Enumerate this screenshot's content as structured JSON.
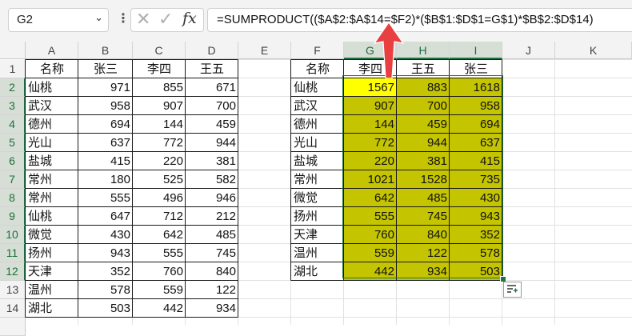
{
  "formula_bar": {
    "name_box": "G2",
    "name_box_arrow": "⌄",
    "menu_glyph": "⋮",
    "cancel_glyph": "✕",
    "enter_glyph": "✓",
    "fx_label": "fx",
    "formula": "=SUMPRODUCT(($A$2:$A$14=$F2)*($B$1:$D$1=G$1)*$B$2:$D$14)"
  },
  "columns": [
    "A",
    "B",
    "C",
    "D",
    "E",
    "F",
    "G",
    "H",
    "I",
    "J",
    "K"
  ],
  "rows": [
    "1",
    "2",
    "3",
    "4",
    "5",
    "6",
    "7",
    "8",
    "9",
    "10",
    "11",
    "12",
    "13",
    "14",
    ""
  ],
  "table_left": {
    "headers": [
      "名称",
      "张三",
      "李四",
      "王五"
    ],
    "rows": [
      [
        "仙桃",
        "971",
        "855",
        "671"
      ],
      [
        "武汉",
        "958",
        "907",
        "700"
      ],
      [
        "德州",
        "694",
        "144",
        "459"
      ],
      [
        "光山",
        "637",
        "772",
        "944"
      ],
      [
        "盐城",
        "415",
        "220",
        "381"
      ],
      [
        "常州",
        "180",
        "525",
        "582"
      ],
      [
        "常州",
        "555",
        "496",
        "946"
      ],
      [
        "仙桃",
        "647",
        "712",
        "212"
      ],
      [
        "微觉",
        "430",
        "642",
        "485"
      ],
      [
        "扬州",
        "943",
        "555",
        "745"
      ],
      [
        "天津",
        "352",
        "760",
        "840"
      ],
      [
        "温州",
        "578",
        "559",
        "122"
      ],
      [
        "湖北",
        "503",
        "442",
        "934"
      ]
    ]
  },
  "table_right": {
    "headers": [
      "名称",
      "李四",
      "王五",
      "张三"
    ],
    "rows": [
      [
        "仙桃",
        "1567",
        "883",
        "1618"
      ],
      [
        "武汉",
        "907",
        "700",
        "958"
      ],
      [
        "德州",
        "144",
        "459",
        "694"
      ],
      [
        "光山",
        "772",
        "944",
        "637"
      ],
      [
        "盐城",
        "220",
        "381",
        "415"
      ],
      [
        "常州",
        "1021",
        "1528",
        "735"
      ],
      [
        "微觉",
        "642",
        "485",
        "430"
      ],
      [
        "扬州",
        "555",
        "745",
        "943"
      ],
      [
        "天津",
        "760",
        "840",
        "352"
      ],
      [
        "温州",
        "559",
        "122",
        "578"
      ],
      [
        "湖北",
        "442",
        "934",
        "503"
      ]
    ]
  },
  "colors": {
    "highlight": "#c4c400",
    "active_cell": "#ffff00",
    "selection_border": "#217346",
    "annotation_arrow": "#e84040"
  },
  "icons": {
    "quick_analysis": "quick-analysis-icon",
    "annotation": "red-arrow-icon"
  }
}
